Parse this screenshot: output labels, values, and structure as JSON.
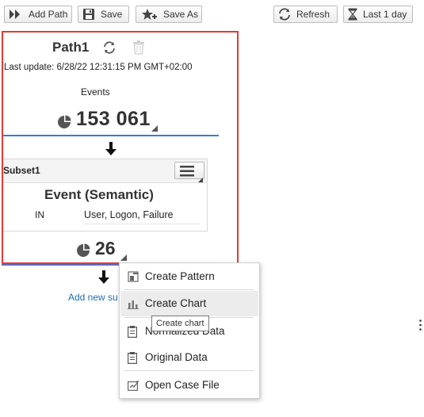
{
  "toolbar": {
    "add_path": "Add Path",
    "save": "Save",
    "save_as": "Save As",
    "refresh": "Refresh",
    "last_period": "Last 1 day"
  },
  "path": {
    "title": "Path1",
    "last_update": "Last update: 6/28/22 12:31:15 PM GMT+02:00",
    "events_label": "Events",
    "events_count": "153 061"
  },
  "subset": {
    "header": "Subset1",
    "name": "Event (Semantic)",
    "operator": "IN",
    "values": "User, Logon, Failure",
    "count": "26"
  },
  "add_subset_link": "Add new su",
  "context_menu": {
    "items": [
      {
        "label": "Create Pattern",
        "icon": "pattern-icon"
      },
      {
        "label": "Create Chart",
        "icon": "bar-chart-icon"
      },
      {
        "label": "Normalized Data",
        "icon": "clipboard-icon"
      },
      {
        "label": "Original Data",
        "icon": "clipboard-icon"
      },
      {
        "label": "Open Case File",
        "icon": "case-file-icon"
      }
    ]
  },
  "tooltip": "Create chart",
  "colors": {
    "selection_border": "#e53935",
    "link": "#1f6fb5",
    "divider_blue": "#2f80d1"
  }
}
